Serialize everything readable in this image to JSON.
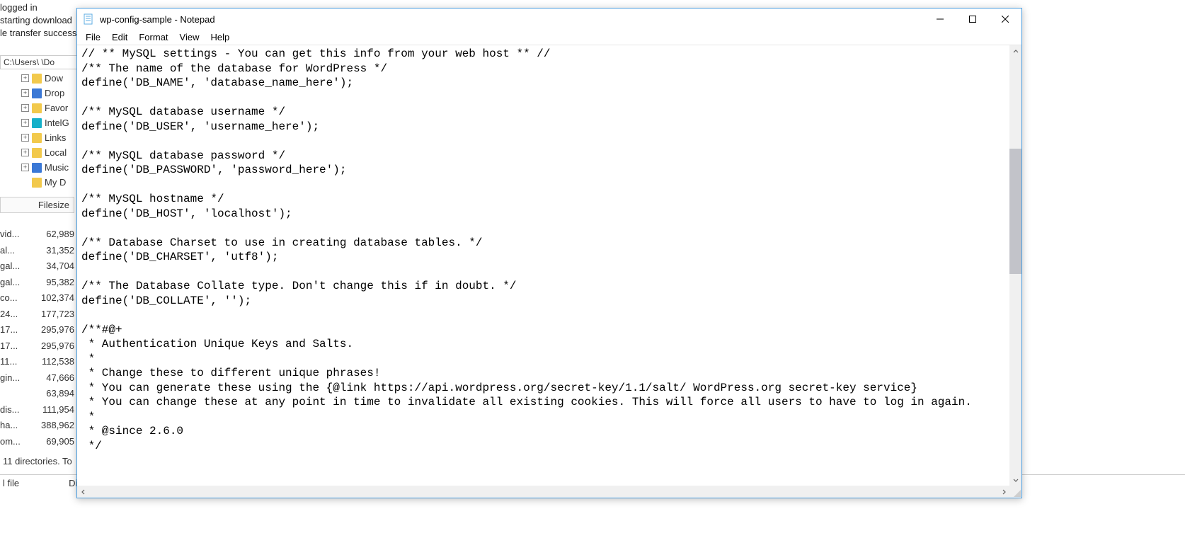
{
  "background": {
    "log_lines": [
      "logged in",
      "starting download",
      "le transfer success"
    ],
    "path": "C:\\Users\\       \\Do",
    "tree": [
      {
        "icon": "yellow",
        "label": "Dow"
      },
      {
        "icon": "blue",
        "label": "Drop"
      },
      {
        "icon": "yellow",
        "label": "Favor"
      },
      {
        "icon": "teal",
        "label": "IntelG"
      },
      {
        "icon": "yellow",
        "label": "Links"
      },
      {
        "icon": "yellow",
        "label": "Local"
      },
      {
        "icon": "blue",
        "label": "Music"
      },
      {
        "icon": "yellow",
        "label": "My D"
      }
    ],
    "filesize_header": "Filesize",
    "file_rows": [
      {
        "name": "vid...",
        "size": "62,989"
      },
      {
        "name": "al...",
        "size": "31,352"
      },
      {
        "name": "gal...",
        "size": "34,704"
      },
      {
        "name": "gal...",
        "size": "95,382"
      },
      {
        "name": "co...",
        "size": "102,374"
      },
      {
        "name": "24...",
        "size": "177,723"
      },
      {
        "name": "17...",
        "size": "295,976"
      },
      {
        "name": "17...",
        "size": "295,976"
      },
      {
        "name": "11...",
        "size": "112,538"
      },
      {
        "name": "gin...",
        "size": "47,666"
      },
      {
        "name": "",
        "size": "63,894"
      },
      {
        "name": "dis...",
        "size": "111,954"
      },
      {
        "name": "ha...",
        "size": "388,962"
      },
      {
        "name": "om...",
        "size": "69,905"
      }
    ],
    "status": "11 directories. To",
    "bottom_left": "l file",
    "bottom_right": "Di"
  },
  "notepad": {
    "title": "wp-config-sample - Notepad",
    "menu": [
      "File",
      "Edit",
      "Format",
      "View",
      "Help"
    ],
    "content": "// ** MySQL settings - You can get this info from your web host ** //\n/** The name of the database for WordPress */\ndefine('DB_NAME', 'database_name_here');\n\n/** MySQL database username */\ndefine('DB_USER', 'username_here');\n\n/** MySQL database password */\ndefine('DB_PASSWORD', 'password_here');\n\n/** MySQL hostname */\ndefine('DB_HOST', 'localhost');\n\n/** Database Charset to use in creating database tables. */\ndefine('DB_CHARSET', 'utf8');\n\n/** The Database Collate type. Don't change this if in doubt. */\ndefine('DB_COLLATE', '');\n\n/**#@+\n * Authentication Unique Keys and Salts.\n *\n * Change these to different unique phrases!\n * You can generate these using the {@link https://api.wordpress.org/secret-key/1.1/salt/ WordPress.org secret-key service}\n * You can change these at any point in time to invalidate all existing cookies. This will force all users to have to log in again.\n *\n * @since 2.6.0\n */",
    "scroll": {
      "thumb_top_pct": 22,
      "thumb_height_pct": 30
    }
  }
}
